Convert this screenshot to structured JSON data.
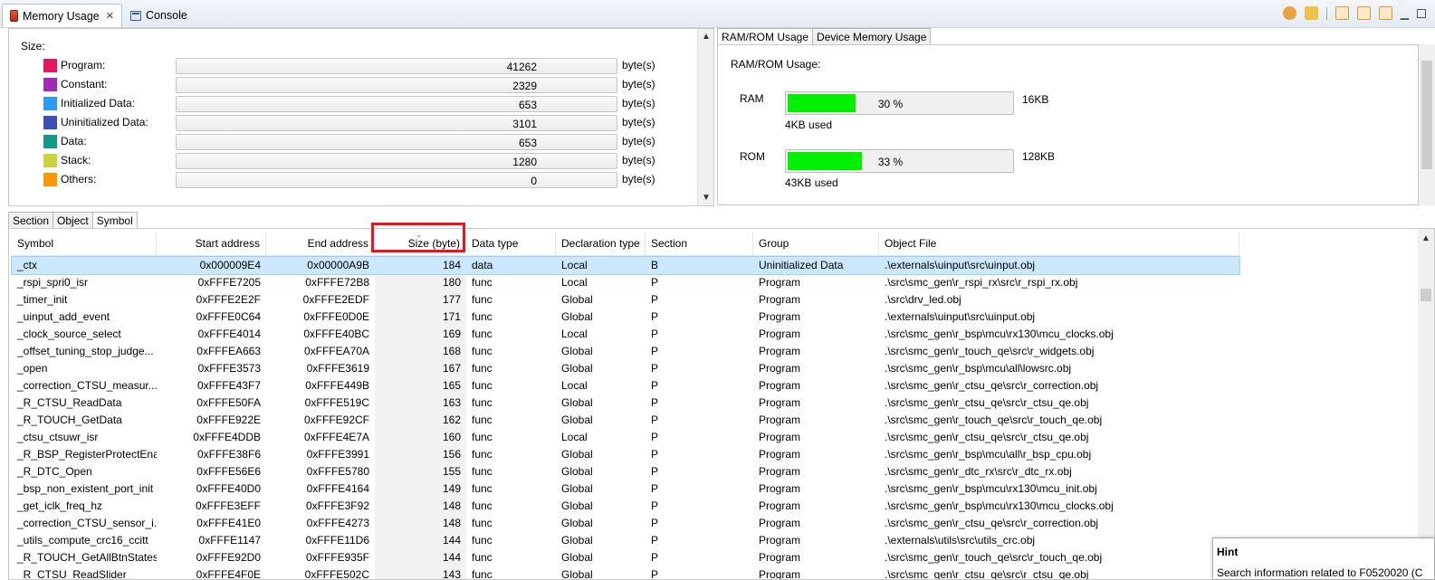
{
  "view_tabs": [
    {
      "label": "Memory Usage",
      "icon": "memory-icon",
      "active": true
    },
    {
      "label": "Console",
      "icon": "console-icon",
      "active": false
    }
  ],
  "size_panel": {
    "title": "Size:",
    "unit": "byte(s)",
    "items": [
      {
        "label": "Program:",
        "value": "41262",
        "color": "#e8175d"
      },
      {
        "label": "Constant:",
        "value": "2329",
        "color": "#a22bb5"
      },
      {
        "label": "Initialized Data:",
        "value": "653",
        "color": "#2a9bf0"
      },
      {
        "label": "Uninitialized Data:",
        "value": "3101",
        "color": "#3b4fb5"
      },
      {
        "label": "Data:",
        "value": "653",
        "color": "#0e9a87"
      },
      {
        "label": "Stack:",
        "value": "1280",
        "color": "#c8d43a"
      },
      {
        "label": "Others:",
        "value": "0",
        "color": "#fb9800"
      }
    ]
  },
  "ramrom": {
    "tabs": [
      "RAM/ROM Usage",
      "Device Memory Usage"
    ],
    "heading": "RAM/ROM Usage:",
    "ram": {
      "name": "RAM",
      "percent_text": "30 %",
      "fraction": 0.3,
      "capacity": "16KB",
      "used": "4KB used"
    },
    "rom": {
      "name": "ROM",
      "percent_text": "33 %",
      "fraction": 0.33,
      "capacity": "128KB",
      "used": "43KB used"
    },
    "bar_color": "#00f000"
  },
  "bottom_tabs": [
    "Section",
    "Object",
    "Symbol"
  ],
  "table": {
    "columns": [
      "Symbol",
      "Start address",
      "End address",
      "Size (byte)",
      "Data type",
      "Declaration type",
      "Section",
      "Group",
      "Object File"
    ],
    "rows": [
      [
        "_ctx",
        "0x000009E4",
        "0x00000A9B",
        "184",
        "data",
        "Local",
        "B",
        "Uninitialized Data",
        ".\\externals\\uinput\\src\\uinput.obj"
      ],
      [
        "_rspi_spri0_isr",
        "0xFFFE7205",
        "0xFFFE72B8",
        "180",
        "func",
        "Local",
        "P",
        "Program",
        ".\\src\\smc_gen\\r_rspi_rx\\src\\r_rspi_rx.obj"
      ],
      [
        "_timer_init",
        "0xFFFE2E2F",
        "0xFFFE2EDF",
        "177",
        "func",
        "Global",
        "P",
        "Program",
        ".\\src\\drv_led.obj"
      ],
      [
        "_uinput_add_event",
        "0xFFFE0C64",
        "0xFFFE0D0E",
        "171",
        "func",
        "Global",
        "P",
        "Program",
        ".\\externals\\uinput\\src\\uinput.obj"
      ],
      [
        "_clock_source_select",
        "0xFFFE4014",
        "0xFFFE40BC",
        "169",
        "func",
        "Local",
        "P",
        "Program",
        ".\\src\\smc_gen\\r_bsp\\mcu\\rx130\\mcu_clocks.obj"
      ],
      [
        "_offset_tuning_stop_judge...",
        "0xFFFEA663",
        "0xFFFEA70A",
        "168",
        "func",
        "Global",
        "P",
        "Program",
        ".\\src\\smc_gen\\r_touch_qe\\src\\r_widgets.obj"
      ],
      [
        "_open",
        "0xFFFE3573",
        "0xFFFE3619",
        "167",
        "func",
        "Global",
        "P",
        "Program",
        ".\\src\\smc_gen\\r_bsp\\mcu\\all\\lowsrc.obj"
      ],
      [
        "_correction_CTSU_measur...",
        "0xFFFE43F7",
        "0xFFFE449B",
        "165",
        "func",
        "Local",
        "P",
        "Program",
        ".\\src\\smc_gen\\r_ctsu_qe\\src\\r_correction.obj"
      ],
      [
        "_R_CTSU_ReadData",
        "0xFFFE50FA",
        "0xFFFE519C",
        "163",
        "func",
        "Global",
        "P",
        "Program",
        ".\\src\\smc_gen\\r_ctsu_qe\\src\\r_ctsu_qe.obj"
      ],
      [
        "_R_TOUCH_GetData",
        "0xFFFE922E",
        "0xFFFE92CF",
        "162",
        "func",
        "Global",
        "P",
        "Program",
        ".\\src\\smc_gen\\r_touch_qe\\src\\r_touch_qe.obj"
      ],
      [
        "_ctsu_ctsuwr_isr",
        "0xFFFE4DDB",
        "0xFFFE4E7A",
        "160",
        "func",
        "Local",
        "P",
        "Program",
        ".\\src\\smc_gen\\r_ctsu_qe\\src\\r_ctsu_qe.obj"
      ],
      [
        "_R_BSP_RegisterProtectEna...",
        "0xFFFE38F6",
        "0xFFFE3991",
        "156",
        "func",
        "Global",
        "P",
        "Program",
        ".\\src\\smc_gen\\r_bsp\\mcu\\all\\r_bsp_cpu.obj"
      ],
      [
        "_R_DTC_Open",
        "0xFFFE56E6",
        "0xFFFE5780",
        "155",
        "func",
        "Global",
        "P",
        "Program",
        ".\\src\\smc_gen\\r_dtc_rx\\src\\r_dtc_rx.obj"
      ],
      [
        "_bsp_non_existent_port_init",
        "0xFFFE40D0",
        "0xFFFE4164",
        "149",
        "func",
        "Global",
        "P",
        "Program",
        ".\\src\\smc_gen\\r_bsp\\mcu\\rx130\\mcu_init.obj"
      ],
      [
        "_get_iclk_freq_hz",
        "0xFFFE3EFF",
        "0xFFFE3F92",
        "148",
        "func",
        "Global",
        "P",
        "Program",
        ".\\src\\smc_gen\\r_bsp\\mcu\\rx130\\mcu_clocks.obj"
      ],
      [
        "_correction_CTSU_sensor_i...",
        "0xFFFE41E0",
        "0xFFFE4273",
        "148",
        "func",
        "Global",
        "P",
        "Program",
        ".\\src\\smc_gen\\r_ctsu_qe\\src\\r_correction.obj"
      ],
      [
        "_utils_compute_crc16_ccitt",
        "0xFFFE1147",
        "0xFFFE11D6",
        "144",
        "func",
        "Global",
        "P",
        "Program",
        ".\\externals\\utils\\src\\utils_crc.obj"
      ],
      [
        "_R_TOUCH_GetAllBtnStates",
        "0xFFFE92D0",
        "0xFFFE935F",
        "144",
        "func",
        "Global",
        "P",
        "Program",
        ".\\src\\smc_gen\\r_touch_qe\\src\\r_touch_qe.obj"
      ],
      [
        "_R_CTSU_ReadSlider",
        "0xFFFE4F0E",
        "0xFFFE502C",
        "143",
        "func",
        "Global",
        "P",
        "Program",
        ".\\src\\smc_gen\\r_ctsu_qe\\src\\r_ctsu_qe.obj"
      ]
    ]
  },
  "hint": {
    "title": "Hint",
    "text": "Search information related to F0520020 (C"
  }
}
